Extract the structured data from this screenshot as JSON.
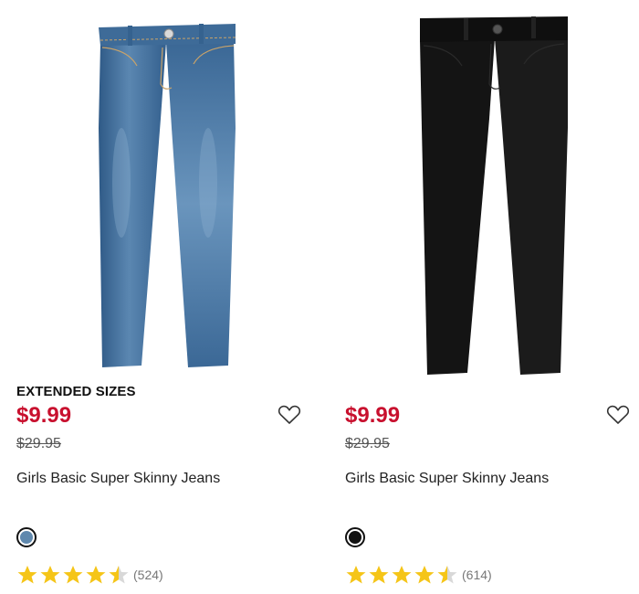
{
  "accent_colors": {
    "sale_price": "#c8102e",
    "star": "#f5c518",
    "star_empty": "#d8d8d8"
  },
  "products": [
    {
      "image_icon": "denim-jeans-image",
      "badge": "EXTENDED SIZES",
      "sale_price": "$9.99",
      "original_price": "$29.95",
      "name": "Girls Basic Super Skinny Jeans",
      "wishlist_icon": "heart-outline-icon",
      "swatch_color": "#5f88ad",
      "rating": 4.5,
      "review_count": "(524)"
    },
    {
      "image_icon": "black-jeans-image",
      "badge": "",
      "sale_price": "$9.99",
      "original_price": "$29.95",
      "name": "Girls Basic Super Skinny Jeans",
      "wishlist_icon": "heart-outline-icon",
      "swatch_color": "#111111",
      "rating": 4.5,
      "review_count": "(614)"
    }
  ]
}
